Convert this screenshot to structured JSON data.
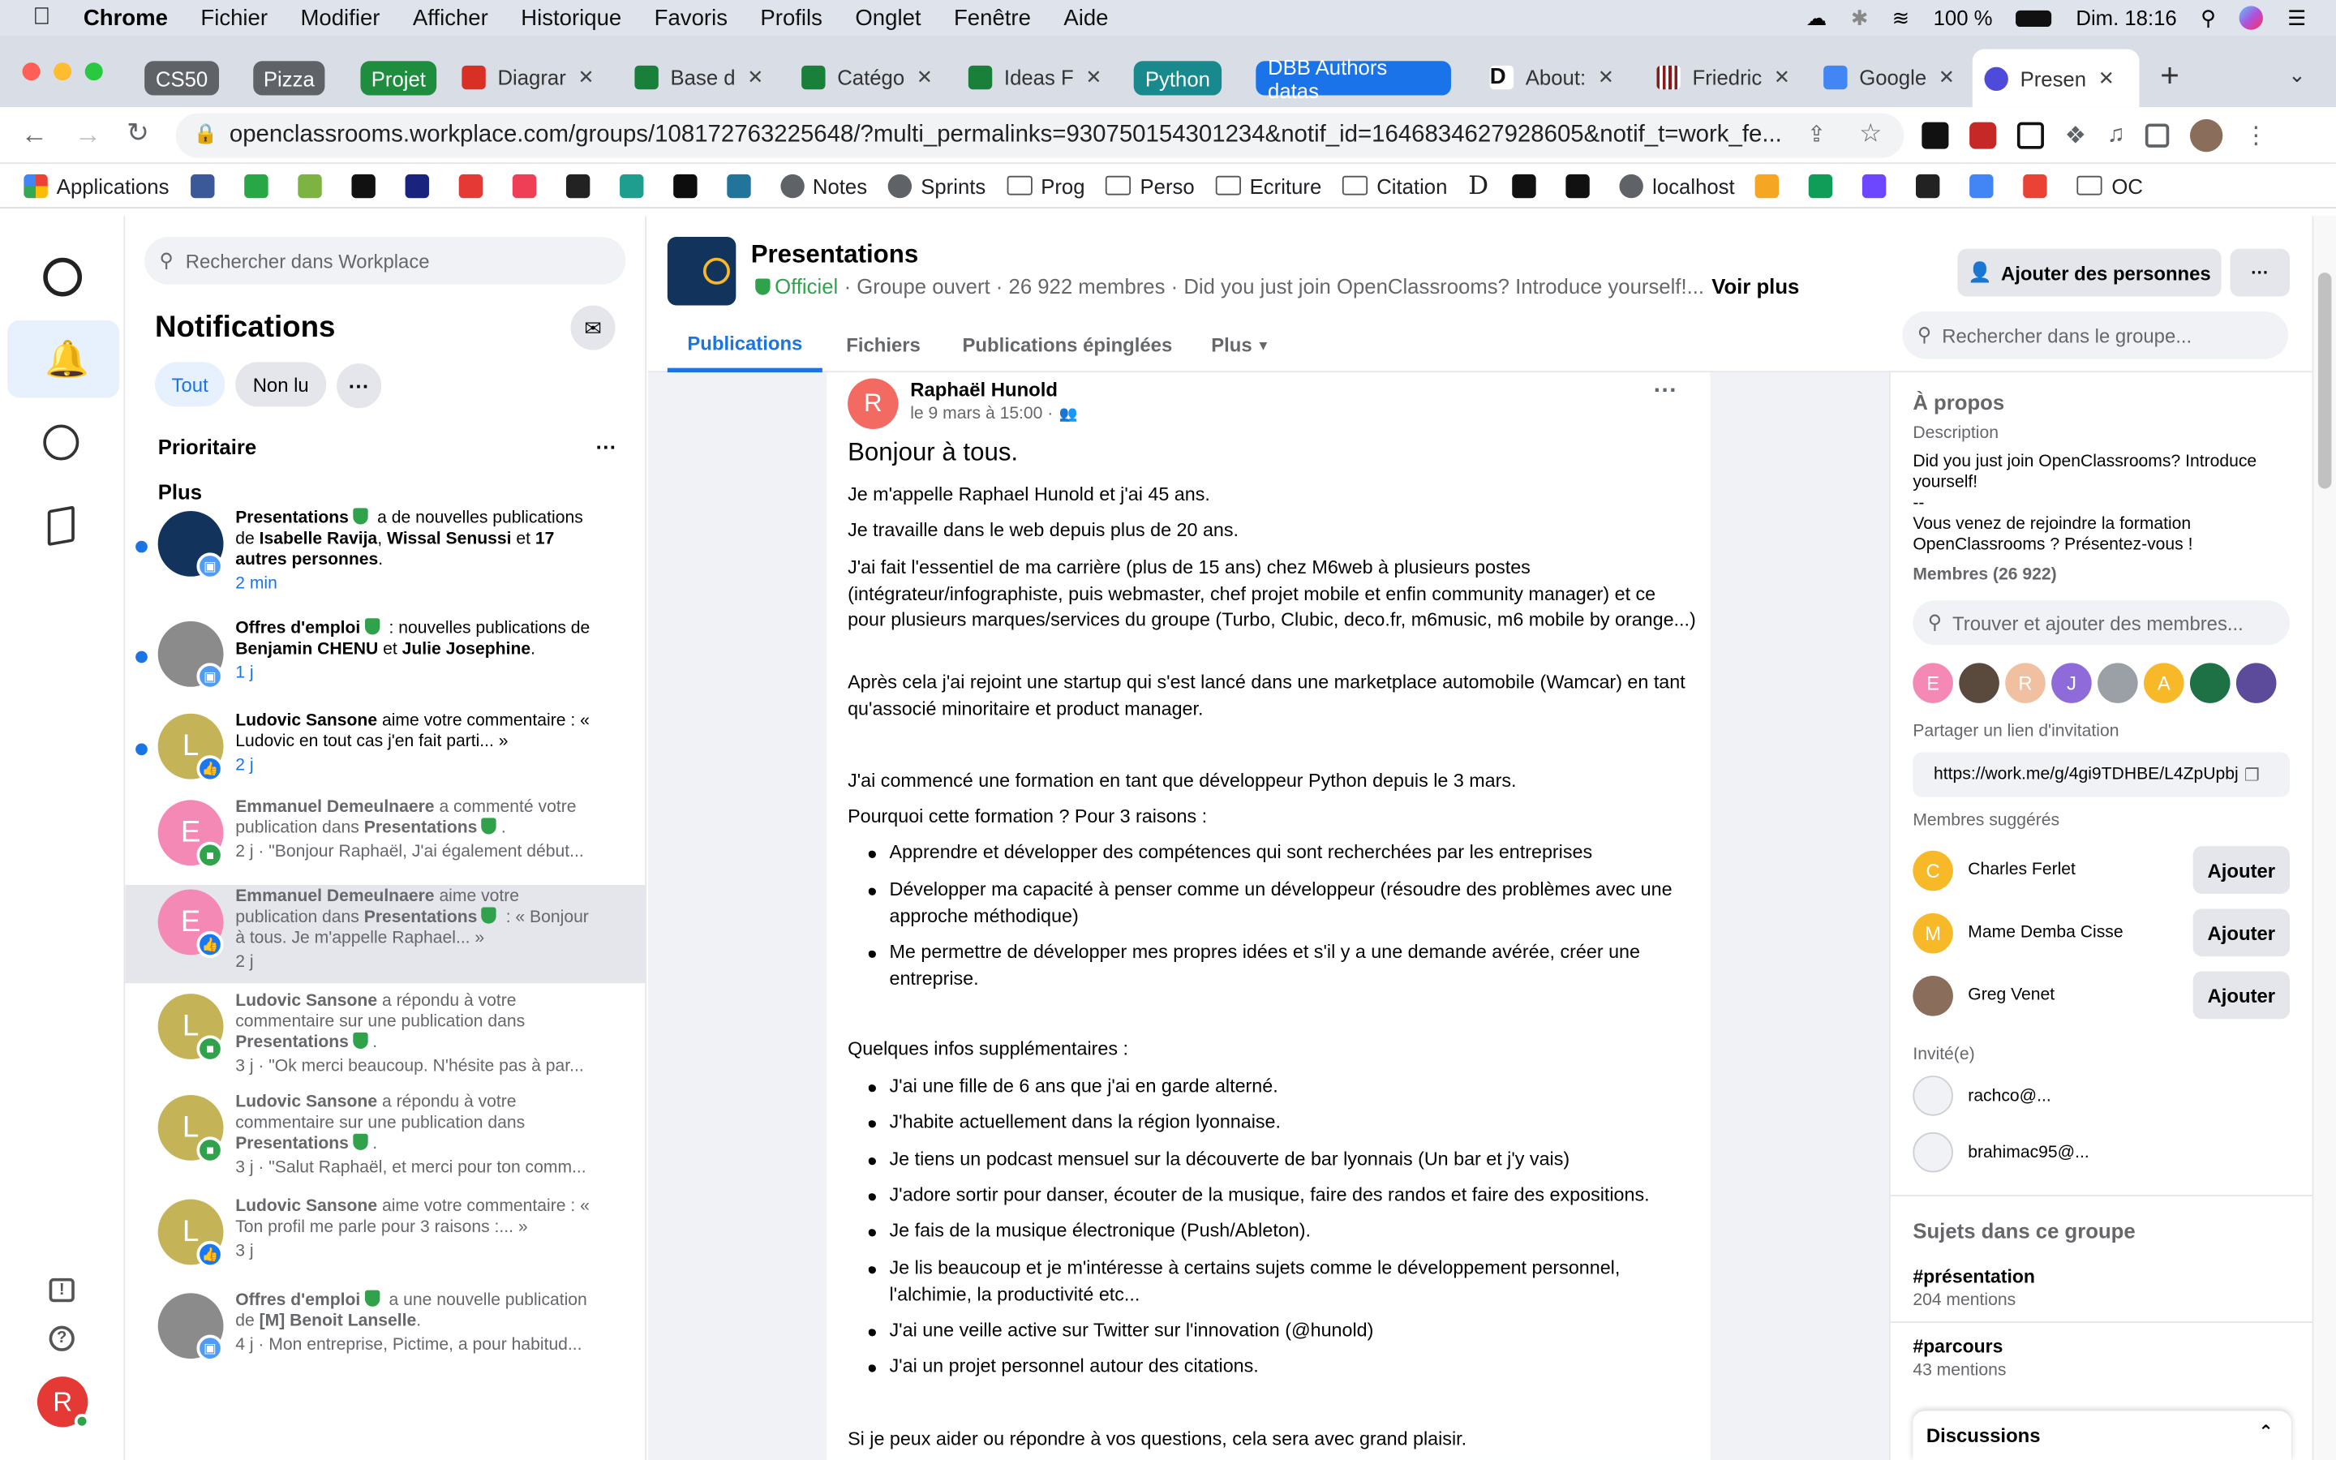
{
  "menubar": {
    "app": "Chrome",
    "items": [
      "Fichier",
      "Modifier",
      "Afficher",
      "Historique",
      "Favoris",
      "Profils",
      "Onglet",
      "Fenêtre",
      "Aide"
    ],
    "battery": "100 %",
    "clock": "Dim. 18:16"
  },
  "tabs": {
    "groups": [
      {
        "label": "CS50",
        "color": "#5f6368"
      },
      {
        "label": "Pizza",
        "color": "#5f6368"
      },
      {
        "label": "Projet",
        "color": "#1e8e3e"
      },
      {
        "label": "Python",
        "color": "#188a8d"
      },
      {
        "label": "DBB Authors datas",
        "color": "#1a73e8"
      }
    ],
    "items": [
      {
        "label": "Diagrar",
        "icon_color": "#d93025"
      },
      {
        "label": "Base d",
        "icon_color": "#188038"
      },
      {
        "label": "Catégo",
        "icon_color": "#188038"
      },
      {
        "label": "Ideas F",
        "icon_color": "#188038"
      },
      {
        "label": "About:",
        "icon_color": "#ffffff"
      },
      {
        "label": "Friedric",
        "icon_color": "#8b1a1a"
      },
      {
        "label": "Google",
        "icon_color": "#4285f4"
      },
      {
        "label": "Presen",
        "icon_color": "#4e4bdb"
      }
    ],
    "new_tab": "+"
  },
  "address": {
    "url": "openclassrooms.workplace.com/groups/108172763225648/?multi_permalinks=930750154301234&notif_id=1646834627928605&notif_t=work_fe..."
  },
  "bookmarks": [
    {
      "label": "Applications",
      "icon": "grid-icon",
      "type": "app"
    },
    {
      "label": "",
      "icon": "bookmark-icon",
      "color": "#3b5998"
    },
    {
      "label": "",
      "icon": "bookmark-icon",
      "color": "#27a745"
    },
    {
      "label": "",
      "icon": "bookmark-icon",
      "color": "#7cb342"
    },
    {
      "label": "",
      "icon": "bookmark-icon",
      "color": "#111111"
    },
    {
      "label": "",
      "icon": "bookmark-icon",
      "color": "#1a237e"
    },
    {
      "label": "",
      "icon": "bookmark-icon",
      "color": "#e53935"
    },
    {
      "label": "",
      "icon": "bookmark-icon",
      "color": "#ef3f56"
    },
    {
      "label": "",
      "icon": "bookmark-icon",
      "color": "#222222"
    },
    {
      "label": "",
      "icon": "bookmark-icon",
      "color": "#1e9e8e"
    },
    {
      "label": "",
      "icon": "bookmark-icon",
      "color": "#0d0d0d"
    },
    {
      "label": "",
      "icon": "bookmark-icon",
      "color": "#21759b"
    },
    {
      "label": "Notes",
      "icon": "notion-icon",
      "type": "link"
    },
    {
      "label": "Sprints",
      "icon": "person-icon",
      "type": "link"
    },
    {
      "label": "Prog",
      "icon": "folder-icon",
      "type": "folder"
    },
    {
      "label": "Perso",
      "icon": "folder-icon",
      "type": "folder"
    },
    {
      "label": "Ecriture",
      "icon": "folder-icon",
      "type": "folder"
    },
    {
      "label": "Citation",
      "icon": "folder-icon",
      "type": "folder"
    },
    {
      "label": "D",
      "icon": "letter-icon",
      "type": "letter"
    },
    {
      "label": "",
      "icon": "check-circle-icon",
      "color": "#111111"
    },
    {
      "label": "",
      "icon": "github-icon",
      "color": "#111111"
    },
    {
      "label": "localhost",
      "icon": "globe-icon",
      "type": "link"
    },
    {
      "label": "",
      "icon": "bookmark-icon",
      "color": "#f5a623"
    },
    {
      "label": "",
      "icon": "drive-icon",
      "color": "#0f9d58"
    },
    {
      "label": "",
      "icon": "bookmark-icon",
      "color": "#6c47ff"
    },
    {
      "label": "",
      "icon": "bookmark-icon",
      "color": "#222222"
    },
    {
      "label": "",
      "icon": "calendar-icon",
      "color": "#4285f4"
    },
    {
      "label": "",
      "icon": "gmail-icon",
      "color": "#ea4335"
    },
    {
      "label": "OC",
      "icon": "folder-icon",
      "type": "folder"
    }
  ],
  "rail": {
    "profile_initial": "R"
  },
  "notifications": {
    "search_placeholder": "Rechercher dans Workplace",
    "title": "Notifications",
    "filter_all": "Tout",
    "filter_unread": "Non lu",
    "section_priority": "Prioritaire",
    "section_more": "Plus",
    "items": [
      {
        "parts": [
          [
            "b",
            "Presentations"
          ],
          [
            "s",
            ""
          ],
          [
            "t",
            " a de nouvelles publications de "
          ],
          [
            "b",
            "Isabelle Ravija"
          ],
          [
            "t",
            ", "
          ],
          [
            "b",
            "Wissal Senussi"
          ],
          [
            "t",
            " et "
          ],
          [
            "b",
            "17 autres personnes"
          ],
          [
            "t",
            "."
          ]
        ],
        "time": "2 min",
        "unread": true,
        "initial": "",
        "avatar_color": "#12335c",
        "badge": "group-icon",
        "badge_color": "#4f9cf6"
      },
      {
        "parts": [
          [
            "b",
            "Offres d'emploi"
          ],
          [
            "s",
            ""
          ],
          [
            "t",
            " : nouvelles publications de "
          ],
          [
            "b",
            "Benjamin CHENU"
          ],
          [
            "t",
            " et "
          ],
          [
            "b",
            "Julie Josephine"
          ],
          [
            "t",
            "."
          ]
        ],
        "time": "1 j",
        "unread": true,
        "initial": "",
        "avatar_color": "#8b8b8b",
        "badge": "group-icon",
        "badge_color": "#4f9cf6"
      },
      {
        "parts": [
          [
            "b",
            "Ludovic Sansone"
          ],
          [
            "t",
            " aime votre commentaire : « Ludovic en tout cas j'en fait parti... »"
          ]
        ],
        "time": "2 j",
        "unread": true,
        "initial": "L",
        "avatar_color": "#c5b358",
        "badge": "like-icon",
        "badge_color": "#1877f2"
      },
      {
        "parts": [
          [
            "b",
            "Emmanuel Demeulnaere"
          ],
          [
            "t",
            " a commenté votre publication dans "
          ],
          [
            "b",
            "Presentations"
          ],
          [
            "s",
            ""
          ],
          [
            "t",
            "."
          ]
        ],
        "time": "2 j · \"Bonjour Raphaël, J'ai également début...",
        "unread": false,
        "initial": "E",
        "avatar_color": "#f589b5",
        "badge": "comment-icon",
        "badge_color": "#31a24c"
      },
      {
        "parts": [
          [
            "b",
            "Emmanuel Demeulnaere"
          ],
          [
            "t",
            " aime votre publication dans "
          ],
          [
            "b",
            "Presentations"
          ],
          [
            "s",
            ""
          ],
          [
            "t",
            " : « Bonjour à tous. Je m'appelle Raphael... »"
          ]
        ],
        "time": "2 j",
        "unread": false,
        "initial": "E",
        "avatar_color": "#f589b5",
        "badge": "like-icon",
        "badge_color": "#1877f2",
        "highlight": true
      },
      {
        "parts": [
          [
            "b",
            "Ludovic Sansone"
          ],
          [
            "t",
            " a répondu à votre commentaire sur une publication dans "
          ],
          [
            "b",
            "Presentations"
          ],
          [
            "s",
            ""
          ],
          [
            "t",
            "."
          ]
        ],
        "time": "3 j · \"Ok merci beaucoup. N'hésite pas à par...",
        "unread": false,
        "initial": "L",
        "avatar_color": "#c5b358",
        "badge": "comment-icon",
        "badge_color": "#31a24c"
      },
      {
        "parts": [
          [
            "b",
            "Ludovic Sansone"
          ],
          [
            "t",
            " a répondu à votre commentaire sur une publication dans "
          ],
          [
            "b",
            "Presentations"
          ],
          [
            "s",
            ""
          ],
          [
            "t",
            "."
          ]
        ],
        "time": "3 j · \"Salut Raphaël, et merci pour ton comm...",
        "unread": false,
        "initial": "L",
        "avatar_color": "#c5b358",
        "badge": "comment-icon",
        "badge_color": "#31a24c"
      },
      {
        "parts": [
          [
            "b",
            "Ludovic Sansone"
          ],
          [
            "t",
            " aime votre commentaire : « Ton profil me parle pour 3 raisons :... »"
          ]
        ],
        "time": "3 j",
        "unread": false,
        "initial": "L",
        "avatar_color": "#c5b358",
        "badge": "like-icon",
        "badge_color": "#1877f2"
      },
      {
        "parts": [
          [
            "b",
            "Offres d'emploi"
          ],
          [
            "s",
            ""
          ],
          [
            "t",
            " a une nouvelle publication de "
          ],
          [
            "b",
            "[M] Benoit Lanselle"
          ],
          [
            "t",
            "."
          ]
        ],
        "time": "4 j · Mon entreprise, Pictime, a pour habitud...",
        "unread": false,
        "initial": "",
        "avatar_color": "#8b8b8b",
        "badge": "group-icon",
        "badge_color": "#4f9cf6"
      }
    ]
  },
  "group": {
    "name": "Presentations",
    "official": "Officiel",
    "meta": "· Groupe ouvert · 26 922 membres · Did you just join OpenClassrooms? Introduce yourself!...",
    "see_more": "Voir plus",
    "add_people": "Ajouter des personnes",
    "more": "···",
    "tabs": [
      "Publications",
      "Fichiers",
      "Publications épinglées",
      "Plus"
    ],
    "search_placeholder": "Rechercher dans le groupe..."
  },
  "post": {
    "author": "Raphaël Hunold",
    "author_initial": "R",
    "date": "le 9 mars à 15:00 ·",
    "heading": "Bonjour à tous.",
    "paragraphs": [
      "Je m'appelle Raphael Hunold et j'ai 45 ans.",
      "Je travaille dans le web depuis plus de 20 ans.",
      "J'ai fait l'essentiel de ma carrière (plus de 15 ans) chez M6web à plusieurs postes (intégrateur/infographiste, puis webmaster, chef projet mobile et enfin community manager) et ce pour plusieurs marques/services du groupe (Turbo, Clubic, deco.fr, m6music, m6 mobile by orange...)",
      "Après cela j'ai rejoint une startup qui s'est lancé dans une marketplace automobile (Wamcar) en tant qu'associé minoritaire et product manager.",
      "J'ai commencé une formation en tant que développeur Python depuis le 3 mars.",
      "Pourquoi cette formation ? Pour 3 raisons :"
    ],
    "reasons": [
      "Apprendre et développer des compétences qui sont recherchées par les entreprises",
      "Développer ma capacité à penser comme un développeur (résoudre des problèmes avec une approche méthodique)",
      "Me permettre de développer mes propres idées et s'il y a une demande avérée, créer une entreprise."
    ],
    "infos_title": "Quelques infos supplémentaires :",
    "infos": [
      "J'ai une fille de 6 ans que j'ai en garde alterné.",
      "J'habite actuellement dans la région lyonnaise.",
      "Je tiens un podcast mensuel sur la découverte de bar lyonnais (Un bar et j'y vais)",
      "J'adore sortir pour danser, écouter de la musique, faire des randos et faire des expositions.",
      "Je fais de la musique électronique (Push/Ableton).",
      "Je lis beaucoup et je m'intéresse à certains sujets comme le développement personnel, l'alchimie, la productivité etc...",
      "J'ai une veille active sur Twitter sur l'innovation (@hunold)",
      "J'ai un projet personnel autour des citations."
    ],
    "closing": "Si je peux aider ou répondre à vos questions, cela sera avec grand plaisir."
  },
  "about": {
    "title": "À propos",
    "desc_label": "Description",
    "desc_lines": [
      "Did you just join OpenClassrooms? Introduce yourself!",
      "--",
      "Vous venez de rejoindre la formation OpenClassrooms ? Présentez-vous !"
    ],
    "members_label": "Membres (26 922)",
    "members_search": "Trouver et ajouter des membres...",
    "member_avatars": [
      {
        "initial": "E",
        "color": "#f589b5"
      },
      {
        "initial": "",
        "color": "#5a4a3e"
      },
      {
        "initial": "R",
        "color": "#f0c0a0"
      },
      {
        "initial": "J",
        "color": "#8e6bd8"
      },
      {
        "initial": "",
        "color": "#9aa0a6"
      },
      {
        "initial": "A",
        "color": "#f7b928"
      },
      {
        "initial": "",
        "color": "#1e7145"
      },
      {
        "initial": "",
        "color": "#5b4b9a"
      }
    ],
    "invite_label": "Partager un lien d'invitation",
    "invite_link": "https://work.me/g/4gi9TDHBE/L4ZpUpbj",
    "suggested_label": "Membres suggérés",
    "suggested": [
      {
        "name": "Charles Ferlet",
        "initial": "C",
        "color": "#f7b928"
      },
      {
        "name": "Mame Demba Cisse",
        "initial": "M",
        "color": "#f7b928"
      },
      {
        "name": "Greg Venet",
        "initial": "",
        "color": "#8a6d5a"
      }
    ],
    "add_label": "Ajouter",
    "invited_label": "Invité(e)",
    "invited": [
      "rachco@...",
      "brahimac95@..."
    ],
    "topics_title": "Sujets dans ce groupe",
    "topics": [
      {
        "tag": "#présentation",
        "count": "204 mentions"
      },
      {
        "tag": "#parcours",
        "count": "43 mentions"
      }
    ],
    "discussions": "Discussions"
  }
}
